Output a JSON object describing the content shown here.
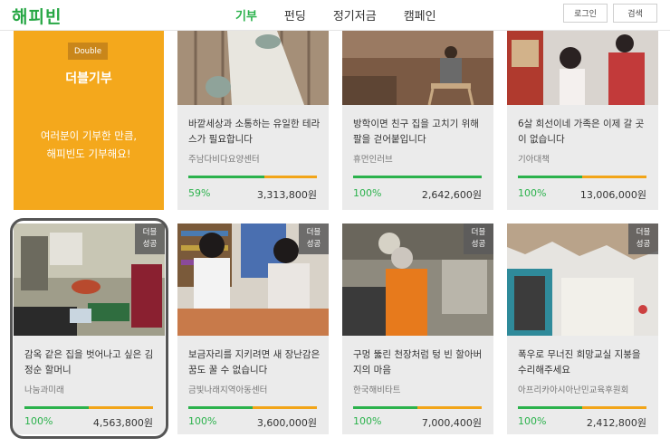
{
  "header": {
    "logo": "해피빈",
    "nav": [
      "기부",
      "펀딩",
      "정기저금",
      "캠페인"
    ],
    "login": "로그인",
    "search": "검색"
  },
  "double_box": {
    "tag": "Double",
    "title": "더블기부",
    "text_line1": "여러분이 기부한 만큼,",
    "text_line2": "해피빈도 기부해요!"
  },
  "row1": [
    {
      "title": "바깥세상과 소통하는 유일한 테라스가 필요합니다",
      "org": "주남다비다요양센터",
      "pct": "59%",
      "pct_value": 59,
      "amount": "3,313,800원"
    },
    {
      "title": "방학이면 친구 집을 고치기 위해 팔을 걷어붙입니다",
      "org": "휴먼인러브",
      "pct": "100%",
      "pct_value": 100,
      "amount": "2,642,600원"
    },
    {
      "title": "6살 희선이네 가족은 이제 갈 곳이 없습니다",
      "org": "기아대책",
      "pct": "100%",
      "pct_value": 100,
      "amount": "13,006,000원"
    }
  ],
  "row2": [
    {
      "badge1": "더블",
      "badge2": "성공",
      "title": "감옥 같은 집을 벗어나고 싶은 김정순 할머니",
      "org": "나눔과미래",
      "pct": "100%",
      "pct_value": 100,
      "amount": "4,563,800원"
    },
    {
      "badge1": "더블",
      "badge2": "성공",
      "title": "보금자리를 지키려면 새 장난감은 꿈도 꿀 수 없습니다",
      "org": "금빛나래지역아동센터",
      "pct": "100%",
      "pct_value": 100,
      "amount": "3,600,000원"
    },
    {
      "badge1": "더블",
      "badge2": "성공",
      "title": "구멍 뚫린 천장처럼 텅 빈 할아버지의 마음",
      "org": "한국해비타트",
      "pct": "100%",
      "pct_value": 100,
      "amount": "7,000,400원"
    },
    {
      "badge1": "더블",
      "badge2": "성공",
      "title": "폭우로 무너진 희망교실 지붕을 수리해주세요",
      "org": "아프리카아시아난민교육후원회",
      "pct": "100%",
      "pct_value": 100,
      "amount": "2,412,800원"
    }
  ]
}
